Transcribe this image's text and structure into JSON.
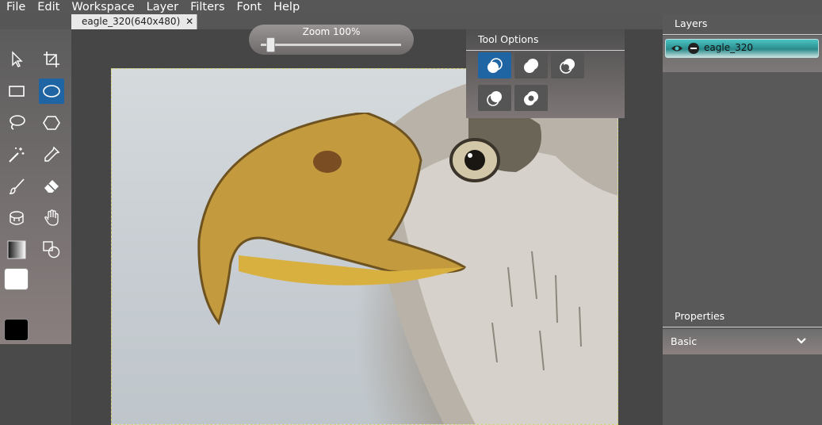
{
  "menu": [
    "File",
    "Edit",
    "Workspace",
    "Layer",
    "Filters",
    "Font",
    "Help"
  ],
  "document_tab": {
    "label": "eagle_320(640x480)",
    "close_glyph": "✕"
  },
  "zoom": {
    "label": "Zoom 100%",
    "value_percent": 100
  },
  "tool_options": {
    "title": "Tool Options",
    "selected_index": 0
  },
  "layers_panel": {
    "title": "Layers",
    "layers": [
      {
        "name": "eagle_320",
        "visible": true,
        "selected": true
      }
    ]
  },
  "properties_panel": {
    "title": "Properties",
    "section": "Basic"
  },
  "colors": {
    "primary": "#000000",
    "secondary": "#ffffff",
    "accent": "#1f64a3",
    "layer_highlight": "#3aa9a9"
  },
  "tools": {
    "active": "ellipse-select",
    "list": [
      "pointer",
      "crop",
      "rect-select",
      "ellipse-select",
      "lasso",
      "polygon-select",
      "magic-wand",
      "eyedropper",
      "brush",
      "eraser",
      "bucket",
      "hand",
      "gradient",
      "clone"
    ]
  }
}
